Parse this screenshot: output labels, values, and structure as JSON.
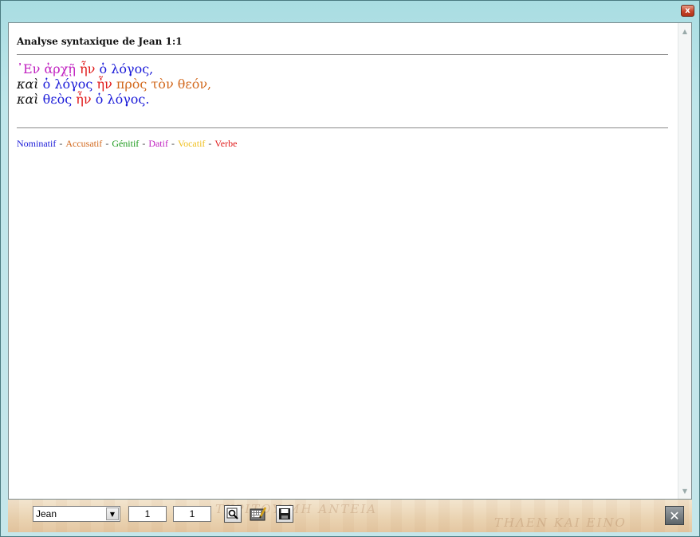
{
  "window": {
    "close_glyph": "x"
  },
  "heading": "Analyse syntaxique de Jean 1:1",
  "verse_lines": [
    [
      {
        "text": "᾿Εν",
        "case": "dat"
      },
      {
        "text": " "
      },
      {
        "text": "ἀρχῇ",
        "case": "dat"
      },
      {
        "text": " "
      },
      {
        "text": "ἦν",
        "case": "verb"
      },
      {
        "text": " "
      },
      {
        "text": "ὁ",
        "case": "nom"
      },
      {
        "text": " "
      },
      {
        "text": "λόγος,",
        "case": "nom"
      }
    ],
    [
      {
        "text": "καὶ",
        "case": "plain"
      },
      {
        "text": " "
      },
      {
        "text": "ὁ",
        "case": "nom"
      },
      {
        "text": " "
      },
      {
        "text": "λόγος",
        "case": "nom"
      },
      {
        "text": " "
      },
      {
        "text": "ἦν",
        "case": "verb"
      },
      {
        "text": " "
      },
      {
        "text": "πρὸς",
        "case": "acc"
      },
      {
        "text": " "
      },
      {
        "text": "τὸν",
        "case": "acc"
      },
      {
        "text": " "
      },
      {
        "text": "θεόν,",
        "case": "acc"
      }
    ],
    [
      {
        "text": "καὶ",
        "case": "plain"
      },
      {
        "text": " "
      },
      {
        "text": "θεὸς",
        "case": "nom"
      },
      {
        "text": " "
      },
      {
        "text": "ἦν",
        "case": "verb"
      },
      {
        "text": " "
      },
      {
        "text": "ὁ",
        "case": "nom"
      },
      {
        "text": " "
      },
      {
        "text": "λόγος.",
        "case": "nom"
      }
    ]
  ],
  "legend": [
    {
      "label": "Nominatif",
      "color": "#1a1ad8"
    },
    {
      "label": "Accusatif",
      "color": "#d2691e"
    },
    {
      "label": "Génitif",
      "color": "#1a9a1a"
    },
    {
      "label": "Datif",
      "color": "#c020c0"
    },
    {
      "label": "Vocatif",
      "color": "#f0c020"
    },
    {
      "label": "Verbe",
      "color": "#e01a1a"
    }
  ],
  "legend_separator": "-",
  "footer": {
    "book": "Jean",
    "chapter": "1",
    "verse": "1",
    "buttons": [
      {
        "name": "search-button",
        "icon": "magnifier-icon"
      },
      {
        "name": "keyboard-edit-button",
        "icon": "keyboard-pencil-icon"
      },
      {
        "name": "save-button",
        "icon": "floppy-disk-icon"
      }
    ],
    "close_glyph": "✕"
  }
}
